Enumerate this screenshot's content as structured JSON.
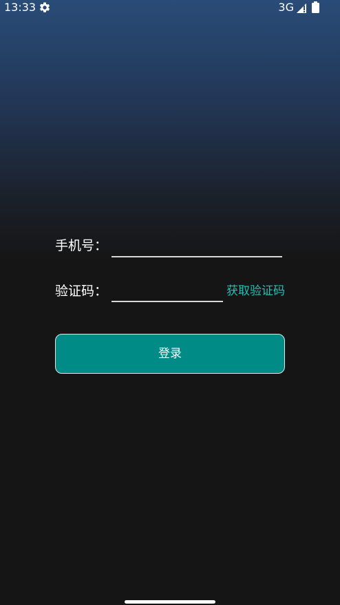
{
  "status_bar": {
    "time": "13:33",
    "network": "3G",
    "icons": [
      "gear-icon",
      "signal-icon",
      "battery-icon"
    ]
  },
  "login_form": {
    "phone_label": "手机号：",
    "phone_value": "",
    "phone_placeholder": "",
    "code_label": "验证码：",
    "code_value": "",
    "code_placeholder": "",
    "get_code_label": "获取验证码",
    "login_button_label": "登录"
  },
  "colors": {
    "background_top": "#294c78",
    "background_bottom": "#151515",
    "accent": "#1bc4b4",
    "button": "#008b87",
    "text": "#ffffff"
  }
}
